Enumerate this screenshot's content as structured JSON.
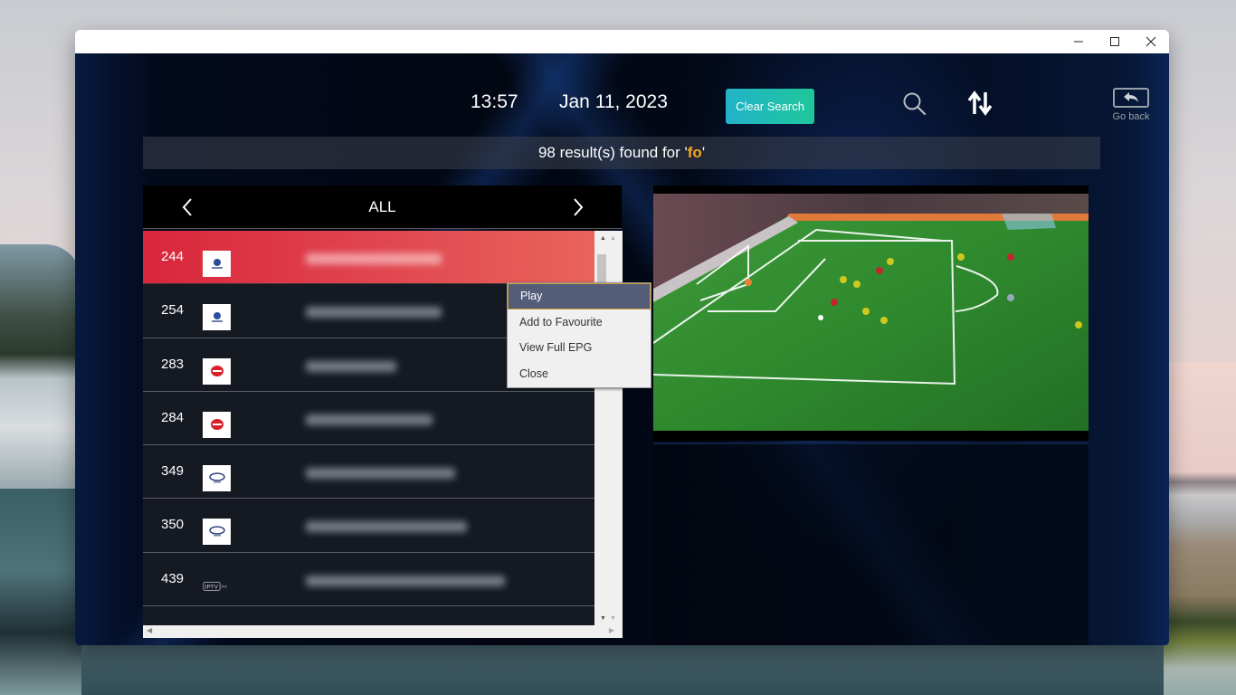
{
  "window": {
    "controls": {
      "minimize": "minimize",
      "maximize": "maximize",
      "close": "close"
    }
  },
  "header": {
    "time": "13:57",
    "date": "Jan 11, 2023",
    "clear_search_label": "Clear Search",
    "search_icon": "search-icon",
    "sort_icon": "sort-icon",
    "go_back_label": "Go back"
  },
  "search": {
    "results_prefix": "98 result(s) found for '",
    "query": "fo",
    "results_suffix": "'"
  },
  "category": {
    "title": "ALL",
    "prev_icon": "chevron-left-icon",
    "next_icon": "chevron-right-icon"
  },
  "channels": [
    {
      "number": "244",
      "logo": "telefe",
      "name_blurred": true,
      "selected": true
    },
    {
      "number": "254",
      "logo": "telefe",
      "name_blurred": true,
      "selected": false
    },
    {
      "number": "283",
      "logo": "foro",
      "name_blurred": true,
      "selected": false
    },
    {
      "number": "284",
      "logo": "foro",
      "name_blurred": true,
      "selected": false
    },
    {
      "number": "349",
      "logo": "fox",
      "name_blurred": true,
      "selected": false
    },
    {
      "number": "350",
      "logo": "fox",
      "name_blurred": true,
      "selected": false
    },
    {
      "number": "439",
      "logo": "iptv",
      "name_blurred": true,
      "selected": false
    }
  ],
  "context_menu": {
    "items": [
      "Play",
      "Add to Favourite",
      "View Full EPG",
      "Close"
    ],
    "active_index": 0
  },
  "colors": {
    "accent_selected": "#d9263c",
    "clear_search_start": "#22b3c9",
    "clear_search_end": "#1fc79a",
    "query_highlight": "#f5a623",
    "menu_active": "#545d78"
  }
}
